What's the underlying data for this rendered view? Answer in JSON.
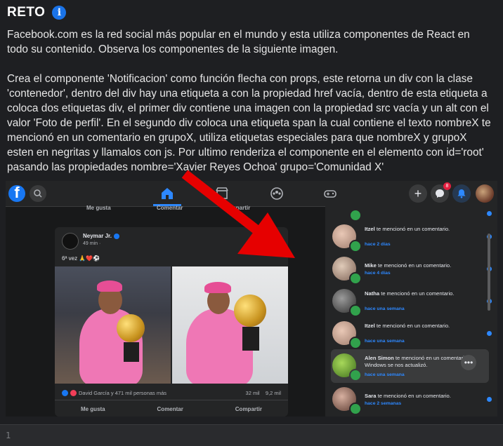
{
  "header": {
    "title": "RETO",
    "info_icon": "info-icon"
  },
  "description": {
    "p1": "Facebook.com es la red social más popular en el mundo y esta utiliza componentes de React en todo su contenido. Observa los componentes de la siguiente imagen.",
    "p2": "Crea el componente 'Notificacion' como función flecha con props, este retorna un div con la clase 'contenedor', dentro del div hay una etiqueta a con la propiedad href vacía, dentro de esta etiqueta a coloca dos etiquetas div, el primer div contiene una imagen con la propiedad src vacía y un alt con el valor 'Foto de perfil'. En el segundo div coloca una etiqueta span la cual contiene el texto nombreX te mencionó en un comentario en grupoX, utiliza etiquetas especiales para que nombreX y grupoX esten en negritas y llamalos con js. Por ultimo renderiza el componente en el elemento con id='root' pasando las propiedades nombre='Xavier Reyes Ochoa' grupo='Comunidad X'"
  },
  "screenshot": {
    "topbar": {
      "messenger_badge": "8"
    },
    "feed_top": {
      "like": "Me gusta",
      "comment": "Comentar",
      "share": "Compartir"
    },
    "post": {
      "author": "Neymar Jr.",
      "time": "49 min · ",
      "text": "6ª vez 🙏❤️⚽",
      "reactions_text": "David García y 471 mil personas más",
      "comments": "32 mil",
      "shares": "9,2 mil",
      "like": "Me gusta",
      "comment": "Comentar",
      "share": "Compartir"
    },
    "notifications": [
      {
        "name": "Itzel",
        "text": " te mencionó en un comentario.",
        "time": "hace 2 días"
      },
      {
        "name": "Mike",
        "text": " te mencionó en un comentario.",
        "time": "hace 4 días"
      },
      {
        "name": "Natha",
        "text": " te mencionó en un comentario.",
        "time": "hace una semana"
      },
      {
        "name": "Itzel",
        "text": " te mencionó en un comentario.",
        "time": "hace una semana"
      },
      {
        "name": "Alen Simon",
        "text": " te mencionó en un comentario en Windows se nos actualizó.",
        "time": "hace una semana"
      },
      {
        "name": "Sara",
        "text": " te mencionó en un comentario.",
        "time": "hace 2 semanas"
      }
    ]
  },
  "editor": {
    "line_number": "1"
  },
  "colors": {
    "facebook_blue": "#1877f2",
    "arrow_red": "#e60000",
    "notif_blue": "#2d88ff"
  }
}
